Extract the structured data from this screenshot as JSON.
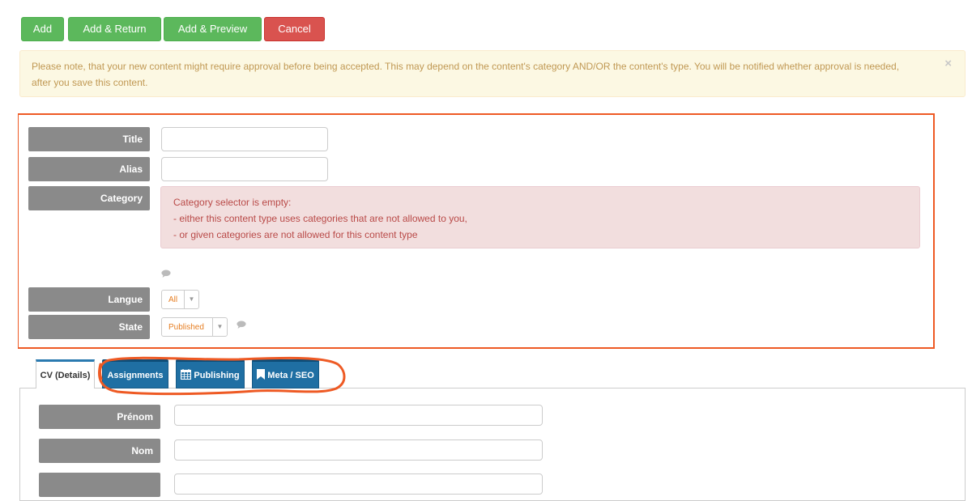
{
  "toolbar": {
    "add_label": "Add",
    "add_return_label": "Add & Return",
    "add_preview_label": "Add & Preview",
    "cancel_label": "Cancel"
  },
  "notice": {
    "text": "Please note, that your new content might require approval before being accepted. This may depend on the content's category AND/OR the content's type. You will be notified whether approval is needed, after you save this content.",
    "close": "×"
  },
  "form": {
    "title_label": "Title",
    "title_value": "",
    "alias_label": "Alias",
    "alias_value": "",
    "category_label": "Category",
    "category_error": [
      "Category selector is empty:",
      "- either this content type uses categories that are not allowed to you,",
      "- or given categories are not allowed for this content type"
    ],
    "langue_label": "Langue",
    "langue_value": "All",
    "state_label": "State",
    "state_value": "Published"
  },
  "tabs": [
    {
      "label": "CV (Details)",
      "active": true,
      "icon": ""
    },
    {
      "label": "Assignments",
      "active": false,
      "icon": ""
    },
    {
      "label": "Publishing",
      "active": false,
      "icon": "calendar-icon"
    },
    {
      "label": "Meta / SEO",
      "active": false,
      "icon": "bookmark-icon"
    }
  ],
  "cv": {
    "prenom_label": "Prénom",
    "prenom_value": "",
    "nom_label": "Nom",
    "nom_value": "",
    "third_label": ""
  },
  "colors": {
    "annotation": "#ee5a24",
    "tab_blue": "#1f6fa3"
  }
}
